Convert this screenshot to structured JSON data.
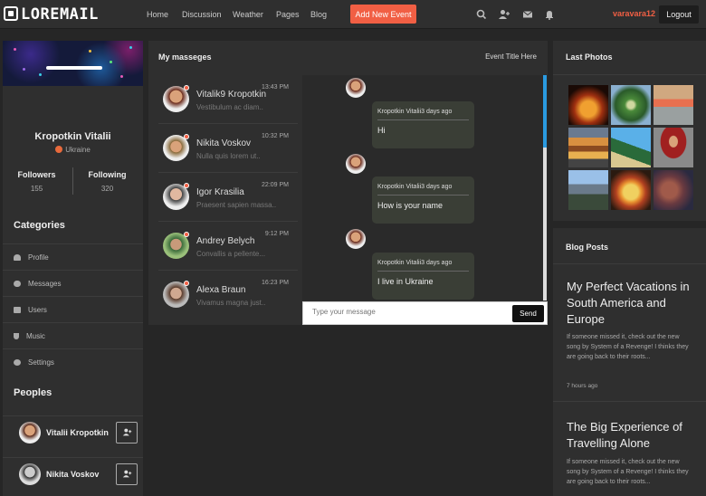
{
  "brand": {
    "name": "LOREMAIL"
  },
  "nav": {
    "items": [
      "Home",
      "Discussion",
      "Weather",
      "Pages",
      "Blog"
    ],
    "add_event": "Add New Event"
  },
  "topbar_icons": [
    "search-icon",
    "add-user-icon",
    "mail-icon",
    "bell-icon"
  ],
  "user": {
    "name": "varavara12",
    "logout": "Logout"
  },
  "profile": {
    "name": "Kropotkin Vitalii",
    "country": "Ukraine",
    "followers_label": "Followers",
    "followers": "155",
    "following_label": "Following",
    "following": "320"
  },
  "categories": {
    "title": "Categories",
    "items": [
      "Profile",
      "Messages",
      "Users",
      "Music",
      "Settings"
    ]
  },
  "peoples": {
    "title": "Peoples",
    "items": [
      "Vitalii Kropotkin",
      "Nikita Voskov"
    ]
  },
  "messages": {
    "title": "My masseges",
    "event_title": "Event Title Here",
    "contacts": [
      {
        "name": "Vitalik9 Kropotkin",
        "preview": "Vestibulum ac diam..",
        "time": "13:43 PM"
      },
      {
        "name": "Nikita Voskov",
        "preview": "Nulla quis lorem ut..",
        "time": "10:32 PM"
      },
      {
        "name": "Igor Krasilia",
        "preview": "Praesent sapien massa..",
        "time": "22:09 PM"
      },
      {
        "name": "Andrey Belych",
        "preview": "Convallis a pellente...",
        "time": "9:12 PM"
      },
      {
        "name": "Alexa Braun",
        "preview": "Vivamus magna just..",
        "time": "16:23 PM"
      }
    ],
    "chat": [
      {
        "header": "Kropotkin Vitalii3 days ago",
        "text": "Hi"
      },
      {
        "header": "Kropotkin Vitalii3 days ago",
        "text": "How is your name"
      },
      {
        "header": "Kropotkin Vitalii3 days ago",
        "text": "I live in Ukraine"
      }
    ],
    "input_placeholder": "Type your message",
    "send": "Send"
  },
  "last_photos": {
    "title": "Last Photos"
  },
  "blog": {
    "title": "Blog Posts",
    "posts": [
      {
        "title": "My Perfect Vacations in South America and Europe",
        "text": "If someone missed it, check out the new song by System of a Revenge! I thinks they are going back to their roots...",
        "time": "7 hours ago"
      },
      {
        "title": "The Big Experience of Travelling Alone",
        "text": "If someone missed it, check out the new song by System of a Revenge! I thinks they are going back to their roots..."
      }
    ]
  }
}
